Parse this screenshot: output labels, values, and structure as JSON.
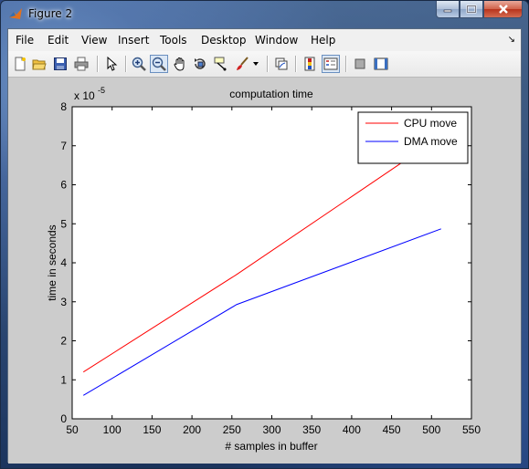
{
  "window": {
    "title": "Figure 2"
  },
  "menubar": {
    "items": [
      "File",
      "Edit",
      "View",
      "Insert",
      "Tools",
      "Desktop",
      "Window",
      "Help"
    ],
    "dock_arrow": "↘"
  },
  "toolbar": {
    "buttons": [
      {
        "name": "new-figure-icon"
      },
      {
        "name": "open-file-icon"
      },
      {
        "name": "save-icon"
      },
      {
        "name": "print-icon"
      },
      {
        "name": "edit-plot-arrow-icon"
      },
      {
        "name": "zoom-in-icon"
      },
      {
        "name": "zoom-out-icon"
      },
      {
        "name": "pan-hand-icon"
      },
      {
        "name": "rotate-3d-icon"
      },
      {
        "name": "data-cursor-icon"
      },
      {
        "name": "brush-icon"
      },
      {
        "name": "link-plot-icon"
      },
      {
        "name": "colorbar-icon"
      },
      {
        "name": "legend-icon"
      },
      {
        "name": "hide-plot-tools-icon"
      },
      {
        "name": "show-plot-tools-icon"
      }
    ]
  },
  "chart_data": {
    "type": "line",
    "title": "computation time",
    "xlabel": "# samples  in buffer",
    "ylabel": "time in seconds",
    "y_exponent_label": "x 10",
    "y_exponent_power": "-5",
    "xlim": [
      50,
      550
    ],
    "ylim": [
      0,
      8
    ],
    "xticks": [
      50,
      100,
      150,
      200,
      250,
      300,
      350,
      400,
      450,
      500,
      550
    ],
    "yticks": [
      0,
      1,
      2,
      3,
      4,
      5,
      6,
      7,
      8
    ],
    "legend_position": "top-right",
    "grid": false,
    "series": [
      {
        "name": "CPU move",
        "color": "#ff0000",
        "x": [
          64,
          256,
          512
        ],
        "y": [
          1.2,
          3.7,
          7.25
        ]
      },
      {
        "name": "DMA move",
        "color": "#0000ff",
        "x": [
          64,
          256,
          512
        ],
        "y": [
          0.6,
          2.93,
          4.87
        ]
      }
    ]
  }
}
